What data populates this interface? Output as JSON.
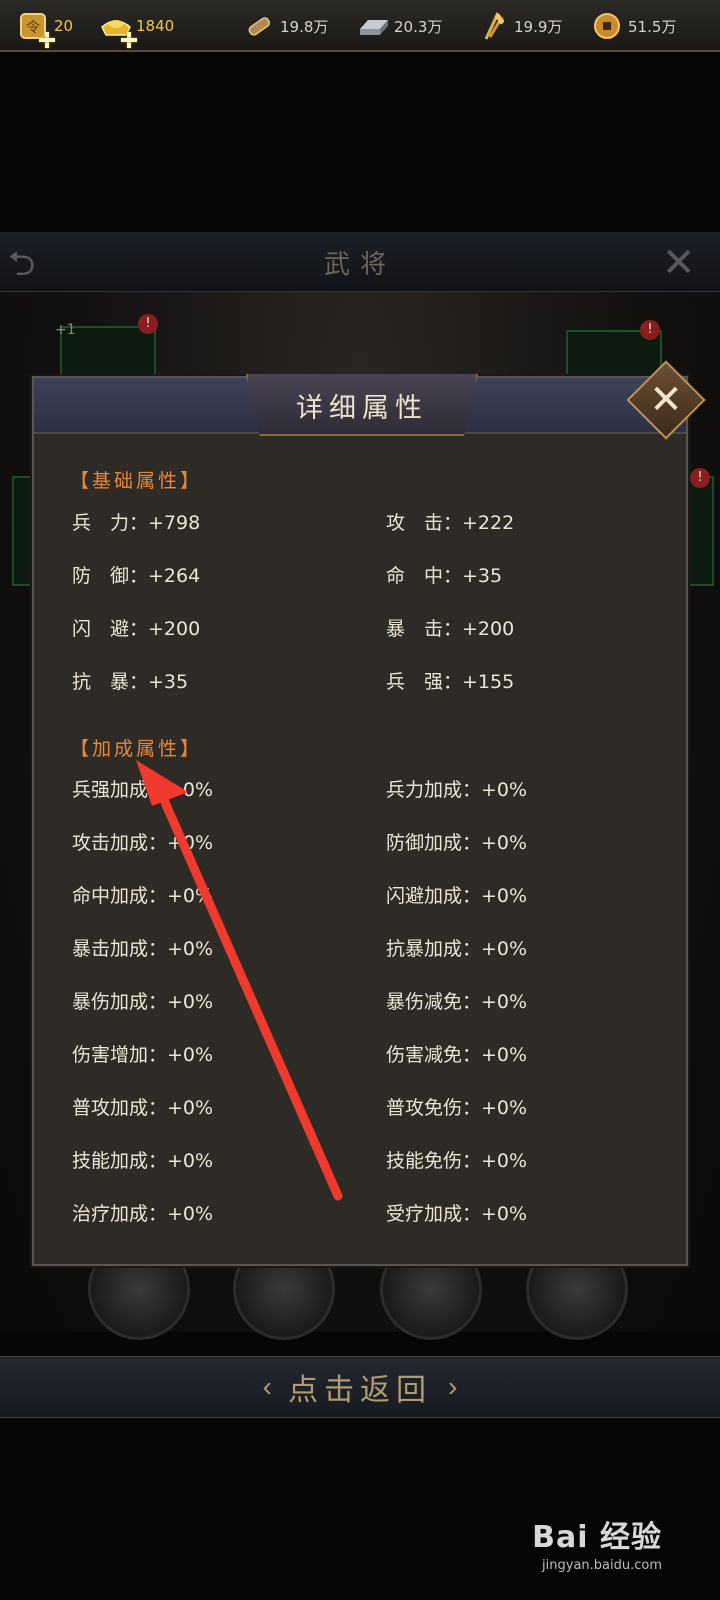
{
  "topbar": {
    "resources": [
      {
        "icon": "token-icon",
        "value": "20"
      },
      {
        "icon": "gold-ingot-icon",
        "value": "1840"
      },
      {
        "icon": "wood-icon",
        "value": "19.8万"
      },
      {
        "icon": "iron-icon",
        "value": "20.3万"
      },
      {
        "icon": "grain-icon",
        "value": "19.9万"
      },
      {
        "icon": "copper-coin-icon",
        "value": "51.5万"
      }
    ]
  },
  "background": {
    "title": "武将",
    "plus_one": "+1",
    "badge": "!"
  },
  "modal": {
    "title": "详细属性",
    "base_section": "【基础属性】",
    "base_attrs": [
      {
        "k": "兵　力：",
        "v": "+798"
      },
      {
        "k": "攻　击：",
        "v": "+222"
      },
      {
        "k": "防　御：",
        "v": "+264"
      },
      {
        "k": "命　中：",
        "v": "+35"
      },
      {
        "k": "闪　避：",
        "v": "+200"
      },
      {
        "k": "暴　击：",
        "v": "+200"
      },
      {
        "k": "抗　暴：",
        "v": "+35"
      },
      {
        "k": "兵　强：",
        "v": "+155"
      }
    ],
    "bonus_section": "【加成属性】",
    "bonus_attrs": [
      {
        "k": "兵强加成：",
        "v": "+0%"
      },
      {
        "k": "兵力加成：",
        "v": "+0%"
      },
      {
        "k": "攻击加成：",
        "v": "+0%"
      },
      {
        "k": "防御加成：",
        "v": "+0%"
      },
      {
        "k": "命中加成：",
        "v": "+0%"
      },
      {
        "k": "闪避加成：",
        "v": "+0%"
      },
      {
        "k": "暴击加成：",
        "v": "+0%"
      },
      {
        "k": "抗暴加成：",
        "v": "+0%"
      },
      {
        "k": "暴伤加成：",
        "v": "+0%"
      },
      {
        "k": "暴伤减免：",
        "v": "+0%"
      },
      {
        "k": "伤害增加：",
        "v": "+0%"
      },
      {
        "k": "伤害减免：",
        "v": "+0%"
      },
      {
        "k": "普攻加成：",
        "v": "+0%"
      },
      {
        "k": "普攻免伤：",
        "v": "+0%"
      },
      {
        "k": "技能加成：",
        "v": "+0%"
      },
      {
        "k": "技能免伤：",
        "v": "+0%"
      },
      {
        "k": "治疗加成：",
        "v": "+0%"
      },
      {
        "k": "受疗加成：",
        "v": "+0%"
      }
    ]
  },
  "bottom": {
    "return_label": "点击返回"
  },
  "watermark": {
    "main": "Bai 经验",
    "sub": "jingyan.baidu.com"
  },
  "colors": {
    "section_orange": "#e8873a",
    "gold_text": "#f2c64a",
    "annotation_red": "#f03a2e"
  }
}
